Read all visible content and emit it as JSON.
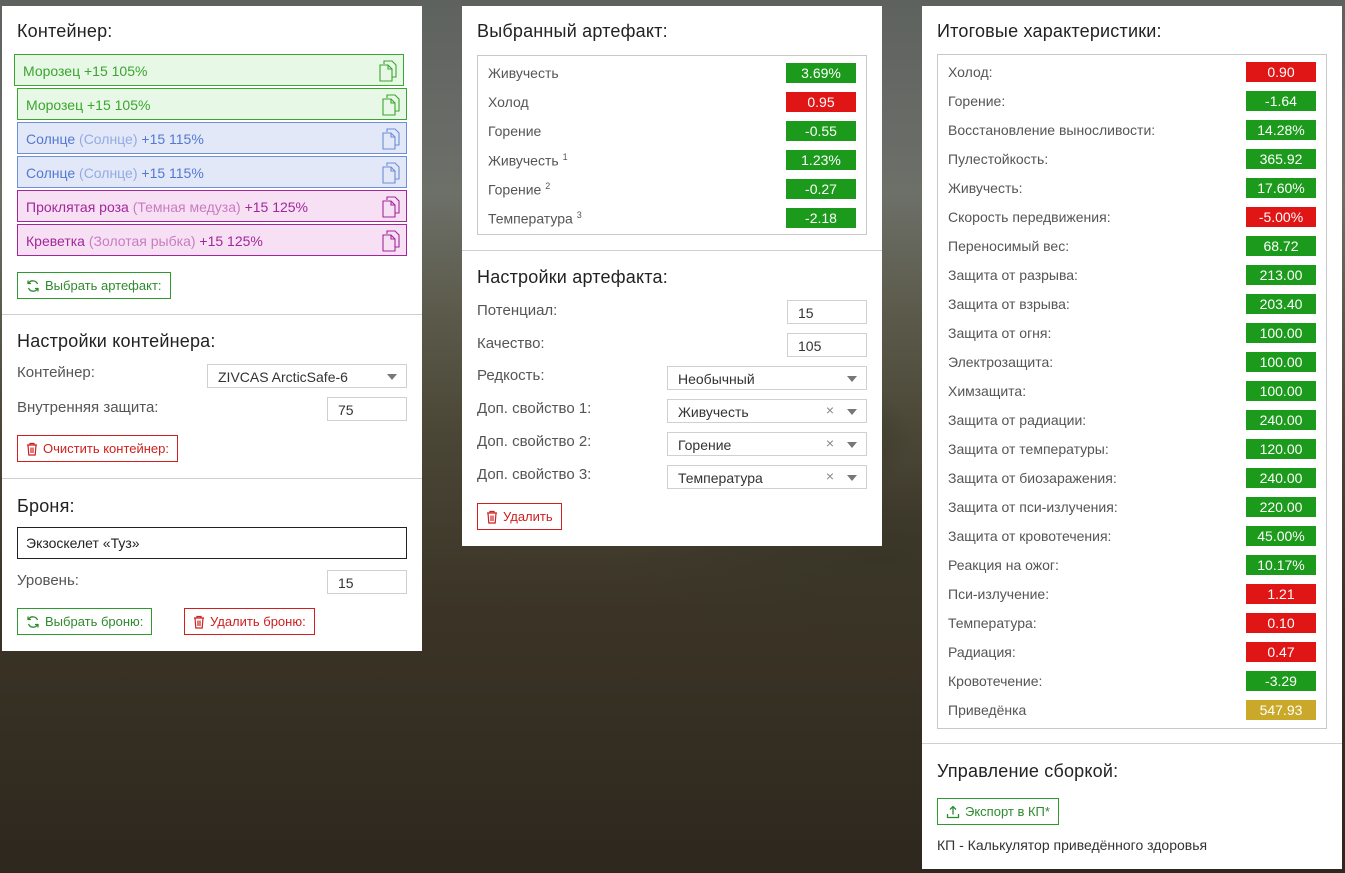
{
  "container_panel": {
    "title": "Контейнер:",
    "artifacts": [
      {
        "name": "Морозец",
        "base": "",
        "bonus": "+15 105%",
        "kind": "green"
      },
      {
        "name": "Морозец",
        "base": "",
        "bonus": "+15 105%",
        "kind": "green"
      },
      {
        "name": "Солнце",
        "base": "(Солнце)",
        "bonus": "+15 115%",
        "kind": "blue"
      },
      {
        "name": "Солнце",
        "base": "(Солнце)",
        "bonus": "+15 115%",
        "kind": "blue"
      },
      {
        "name": "Проклятая роза",
        "base": "(Темная медуза)",
        "bonus": "+15 125%",
        "kind": "pink"
      },
      {
        "name": "Креветка",
        "base": "(Золотая рыбка)",
        "bonus": "+15 125%",
        "kind": "pink"
      }
    ],
    "choose_artifact_label": "Выбрать артефакт:"
  },
  "container_settings": {
    "title": "Настройки контейнера:",
    "container_label": "Контейнер:",
    "container_value": "ZIVCAS ArcticSafe-6",
    "protection_label": "Внутренняя защита:",
    "protection_value": "75",
    "clear_label": "Очистить контейнер:"
  },
  "armor": {
    "title": "Броня:",
    "value": "Экзоскелет «Туз»",
    "level_label": "Уровень:",
    "level_value": "15",
    "choose_label": "Выбрать броню:",
    "delete_label": "Удалить броню:"
  },
  "selected_artifact": {
    "title": "Выбранный артефакт:",
    "stats": [
      {
        "name": "Живучесть",
        "sup": "",
        "value": "3.69%",
        "color": "green"
      },
      {
        "name": "Холод",
        "sup": "",
        "value": "0.95",
        "color": "red"
      },
      {
        "name": "Горение",
        "sup": "",
        "value": "-0.55",
        "color": "green"
      },
      {
        "name": "Живучесть",
        "sup": "1",
        "value": "1.23%",
        "color": "green"
      },
      {
        "name": "Горение",
        "sup": "2",
        "value": "-0.27",
        "color": "green"
      },
      {
        "name": "Температура",
        "sup": "3",
        "value": "-2.18",
        "color": "green"
      }
    ]
  },
  "artifact_settings": {
    "title": "Настройки артефакта:",
    "potential_label": "Потенциал:",
    "potential_value": "15",
    "quality_label": "Качество:",
    "quality_value": "105",
    "rarity_label": "Редкость:",
    "rarity_value": "Необычный",
    "extra1_label": "Доп. свойство 1:",
    "extra1_value": "Живучесть",
    "extra2_label": "Доп. свойство 2:",
    "extra2_value": "Горение",
    "extra3_label": "Доп. свойство 3:",
    "extra3_value": "Температура",
    "clear_symbol": "×",
    "delete_label": "Удалить"
  },
  "totals": {
    "title": "Итоговые характеристики:",
    "stats": [
      {
        "name": "Холод:",
        "value": "0.90",
        "color": "red"
      },
      {
        "name": "Горение:",
        "value": "-1.64",
        "color": "green"
      },
      {
        "name": "Восстановление выносливости:",
        "value": "14.28%",
        "color": "green"
      },
      {
        "name": "Пулестойкость:",
        "value": "365.92",
        "color": "green"
      },
      {
        "name": "Живучесть:",
        "value": "17.60%",
        "color": "green"
      },
      {
        "name": "Скорость передвижения:",
        "value": "-5.00%",
        "color": "red"
      },
      {
        "name": "Переносимый вес:",
        "value": "68.72",
        "color": "green"
      },
      {
        "name": "Защита от разрыва:",
        "value": "213.00",
        "color": "green"
      },
      {
        "name": "Защита от взрыва:",
        "value": "203.40",
        "color": "green"
      },
      {
        "name": "Защита от огня:",
        "value": "100.00",
        "color": "green"
      },
      {
        "name": "Электрозащита:",
        "value": "100.00",
        "color": "green"
      },
      {
        "name": "Химзащита:",
        "value": "100.00",
        "color": "green"
      },
      {
        "name": "Защита от радиации:",
        "value": "240.00",
        "color": "green"
      },
      {
        "name": "Защита от температуры:",
        "value": "120.00",
        "color": "green"
      },
      {
        "name": "Защита от биозаражения:",
        "value": "240.00",
        "color": "green"
      },
      {
        "name": "Защита от пси-излучения:",
        "value": "220.00",
        "color": "green"
      },
      {
        "name": "Защита от кровотечения:",
        "value": "45.00%",
        "color": "green"
      },
      {
        "name": "Реакция на ожог:",
        "value": "10.17%",
        "color": "green"
      },
      {
        "name": "Пси-излучение:",
        "value": "1.21",
        "color": "red"
      },
      {
        "name": "Температура:",
        "value": "0.10",
        "color": "red"
      },
      {
        "name": "Радиация:",
        "value": "0.47",
        "color": "red"
      },
      {
        "name": "Кровотечение:",
        "value": "-3.29",
        "color": "green"
      },
      {
        "name": "Приведёнка",
        "value": "547.93",
        "color": "gold"
      }
    ]
  },
  "build_management": {
    "title": "Управление сборкой:",
    "export_label": "Экспорт в КП*",
    "note": "КП - Калькулятор приведённого здоровья"
  },
  "colors": {
    "green": "#1c9a1c",
    "red": "#e01515",
    "gold": "#c9a82a"
  }
}
